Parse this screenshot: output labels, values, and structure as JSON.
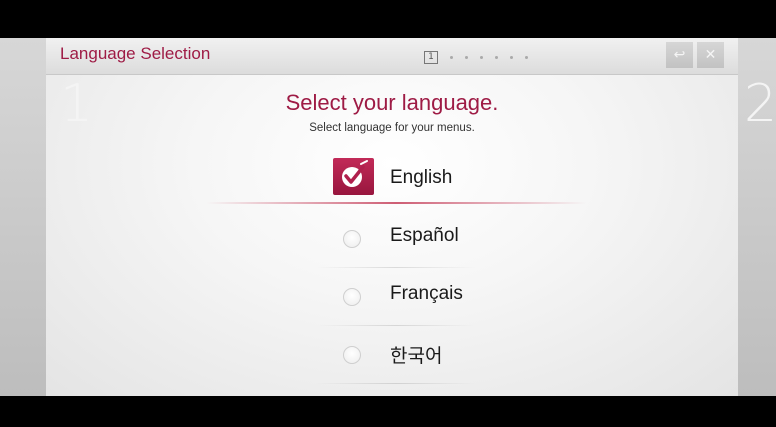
{
  "header": {
    "title": "Language Selection",
    "page_indicator": "1",
    "page_count_dots": 6,
    "back_symbol": "↩",
    "close_symbol": "✕"
  },
  "step": {
    "current": "1",
    "next": "2"
  },
  "main": {
    "heading": "Select your language.",
    "subheading": "Select language for your menus."
  },
  "languages": [
    {
      "label": "English",
      "selected": true
    },
    {
      "label": "Español",
      "selected": false
    },
    {
      "label": "Français",
      "selected": false
    },
    {
      "label": "한국어",
      "selected": false
    }
  ],
  "colors": {
    "accent": "#9e1b45",
    "check_bg": "#b0204d"
  },
  "icons": {
    "back": "back-arrow-icon",
    "close": "close-icon",
    "check": "checkmark-icon"
  }
}
